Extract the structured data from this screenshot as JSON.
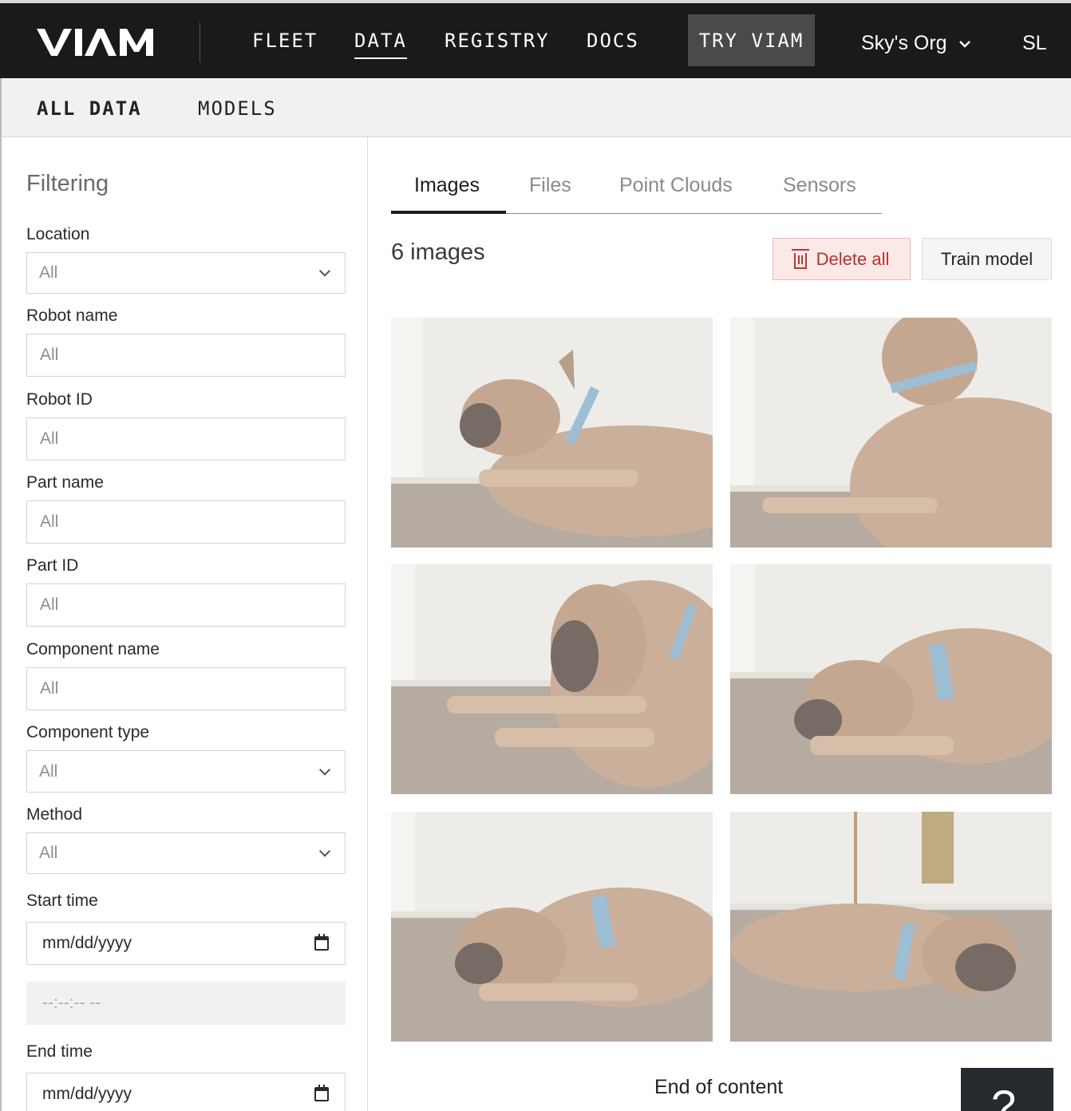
{
  "topnav": {
    "logo_text": "VIAM",
    "links": [
      "FLEET",
      "DATA",
      "REGISTRY",
      "DOCS"
    ],
    "active_link": "DATA",
    "try_label": "TRY VIAM",
    "org_label": "Sky's Org",
    "avatar_initials": "SL"
  },
  "subnav": {
    "links": [
      "ALL DATA",
      "MODELS"
    ],
    "active": "ALL DATA"
  },
  "sidebar": {
    "title": "Filtering",
    "fields": [
      {
        "label": "Location",
        "type": "select",
        "value": "All"
      },
      {
        "label": "Robot name",
        "type": "input",
        "placeholder": "All"
      },
      {
        "label": "Robot ID",
        "type": "input",
        "placeholder": "All"
      },
      {
        "label": "Part name",
        "type": "input",
        "placeholder": "All"
      },
      {
        "label": "Part ID",
        "type": "input",
        "placeholder": "All"
      },
      {
        "label": "Component name",
        "type": "input",
        "placeholder": "All"
      },
      {
        "label": "Component type",
        "type": "select",
        "value": "All"
      },
      {
        "label": "Method",
        "type": "select",
        "value": "All"
      }
    ],
    "start_time": {
      "label": "Start time",
      "date_placeholder": "mm/dd/yyyy",
      "time_placeholder": "--:--:-- --"
    },
    "end_time": {
      "label": "End time",
      "date_placeholder": "mm/dd/yyyy"
    }
  },
  "main": {
    "tabs": [
      "Images",
      "Files",
      "Point Clouds",
      "Sensors"
    ],
    "active_tab": "Images",
    "count_label": "6 images",
    "delete_label": "Delete all",
    "train_label": "Train model",
    "images_count": 6,
    "end_label": "End of content",
    "help_label": "?"
  },
  "colors": {
    "nav_bg": "#1a1a1a",
    "subnav_bg": "#f0f1f3",
    "delete_bg": "#fbe9e8",
    "delete_text": "#b8312a",
    "dog": "#b08a6c",
    "collar": "#6aa3c8"
  }
}
